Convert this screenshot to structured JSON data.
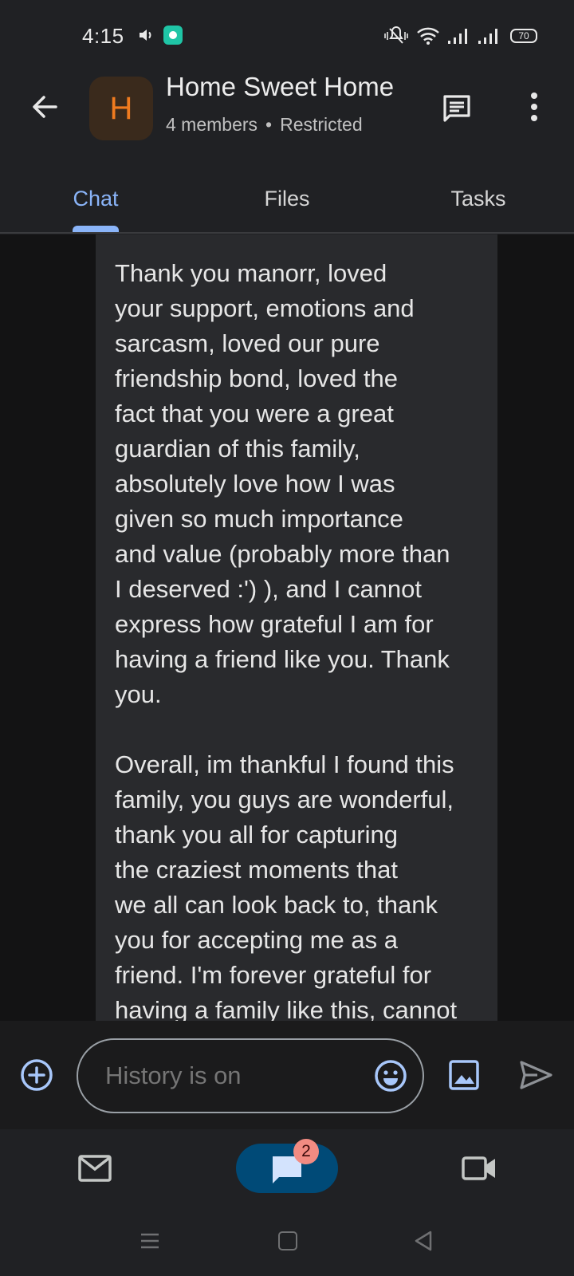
{
  "status_bar": {
    "time": "4:15",
    "battery": "70"
  },
  "header": {
    "avatar_letter": "H",
    "title": "Home Sweet Home",
    "members": "4 members",
    "separator": "•",
    "access": "Restricted"
  },
  "tabs": [
    {
      "label": "Chat",
      "active": true
    },
    {
      "label": "Files",
      "active": false
    },
    {
      "label": "Tasks",
      "active": false
    }
  ],
  "message": {
    "paragraph_1": "Thank you manorr, loved\nyour support, emotions and\nsarcasm, loved our pure\nfriendship bond, loved the\nfact that you were a great\nguardian of this family,\nabsolutely love how I was\ngiven so much importance\nand value (probably more than\nI deserved :') ), and I cannot\nexpress how grateful I am for\nhaving a friend like you. Thank\nyou.",
    "paragraph_2": "Overall, im thankful I found this\nfamily, you guys are wonderful,\nthank you all for capturing\nthe craziest moments that\nwe all can look back to, thank\nyou for accepting me as a\nfriend. I'm forever grateful for\nhaving a family like this, cannot"
  },
  "composer": {
    "placeholder": "History is on"
  },
  "bottom_nav": {
    "chat_badge": "2"
  },
  "colors": {
    "accent": "#8ab4f8",
    "avatar_bg": "#3a2a1c",
    "avatar_fg": "#f07b1f",
    "bubble_bg": "#292a2d",
    "chat_pill": "#004a77",
    "badge": "#f28b82"
  }
}
